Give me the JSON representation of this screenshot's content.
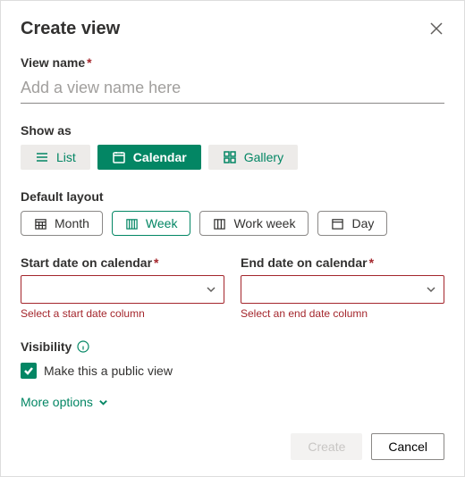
{
  "header": {
    "title": "Create view"
  },
  "viewName": {
    "label": "View name",
    "placeholder": "Add a view name here",
    "value": ""
  },
  "showAs": {
    "label": "Show as",
    "options": {
      "list": "List",
      "calendar": "Calendar",
      "gallery": "Gallery"
    },
    "selected": "calendar"
  },
  "defaultLayout": {
    "label": "Default layout",
    "options": {
      "month": "Month",
      "week": "Week",
      "workweek": "Work week",
      "day": "Day"
    },
    "selected": "week"
  },
  "startDate": {
    "label": "Start date on calendar",
    "error": "Select a start date column"
  },
  "endDate": {
    "label": "End date on calendar",
    "error": "Select an end date column"
  },
  "visibility": {
    "label": "Visibility",
    "checkboxLabel": "Make this a public view",
    "checked": true
  },
  "more": {
    "label": "More options"
  },
  "footer": {
    "create": "Create",
    "cancel": "Cancel"
  }
}
